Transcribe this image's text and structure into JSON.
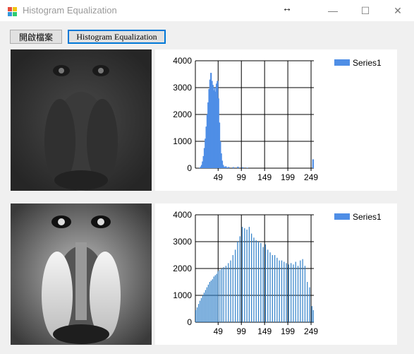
{
  "window": {
    "title": "Histogram Equalization",
    "minimize_glyph": "—",
    "maximize_glyph": "☐",
    "close_glyph": "✕",
    "cursor_glyph": "↔"
  },
  "toolbar": {
    "open_label": "開啟檔案",
    "equalize_label": "Histogram Equalization"
  },
  "images": {
    "original": {
      "description_icon": "baboon-image-dark"
    },
    "equalized": {
      "description_icon": "baboon-image-equalized"
    }
  },
  "chart_data": [
    {
      "type": "bar",
      "legend": "Series1",
      "legend_position": "top-right",
      "ylim": [
        0,
        4000
      ],
      "yticks": [
        "0",
        "1000",
        "2000",
        "3000",
        "4000"
      ],
      "xticks": [
        "49",
        "99",
        "149",
        "199",
        "249"
      ],
      "xlim": [
        0,
        255
      ],
      "grid": true,
      "color": "#4f8ee6",
      "series": [
        {
          "name": "Series1",
          "x": [
            8,
            10,
            12,
            14,
            16,
            18,
            20,
            22,
            24,
            26,
            28,
            30,
            32,
            34,
            36,
            38,
            40,
            42,
            44,
            46,
            48,
            50,
            52,
            54,
            56,
            58,
            60,
            62,
            64,
            66,
            70,
            80,
            90,
            100,
            110,
            255
          ],
          "values": [
            20,
            60,
            120,
            250,
            450,
            750,
            1100,
            1550,
            2000,
            2450,
            2950,
            3300,
            3550,
            3250,
            3100,
            2900,
            3000,
            2850,
            3150,
            3250,
            2600,
            1700,
            1000,
            550,
            280,
            120,
            60,
            40,
            70,
            30,
            45,
            40,
            55,
            35,
            20,
            330
          ]
        }
      ]
    },
    {
      "type": "bar",
      "legend": "Series1",
      "legend_position": "top-right",
      "ylim": [
        0,
        4000
      ],
      "yticks": [
        "0",
        "1000",
        "2000",
        "3000",
        "4000"
      ],
      "xticks": [
        "49",
        "99",
        "149",
        "199",
        "249"
      ],
      "xlim": [
        0,
        255
      ],
      "grid": true,
      "color": "#2e7fc8",
      "series": [
        {
          "name": "Series1",
          "x": [
            0,
            3,
            6,
            9,
            12,
            15,
            18,
            21,
            24,
            27,
            30,
            33,
            36,
            39,
            42,
            45,
            48,
            52,
            56,
            60,
            65,
            70,
            75,
            80,
            85,
            90,
            95,
            100,
            105,
            110,
            115,
            120,
            125,
            130,
            135,
            140,
            145,
            150,
            155,
            160,
            165,
            170,
            175,
            180,
            185,
            190,
            195,
            200,
            205,
            210,
            215,
            220,
            225,
            230,
            235,
            240,
            245,
            250,
            253
          ],
          "values": [
            450,
            550,
            680,
            800,
            900,
            1000,
            1100,
            1200,
            1300,
            1400,
            1500,
            1550,
            1600,
            1700,
            1750,
            1800,
            1900,
            1950,
            2000,
            2050,
            2100,
            2200,
            2300,
            2500,
            2700,
            3000,
            3200,
            3550,
            3500,
            3450,
            3550,
            3300,
            3150,
            3050,
            3000,
            2950,
            2800,
            2900,
            2700,
            2600,
            2500,
            2500,
            2400,
            2300,
            2300,
            2250,
            2200,
            2150,
            2200,
            2150,
            2250,
            2100,
            2300,
            2350,
            2100,
            1500,
            1300,
            600,
            450
          ]
        }
      ]
    }
  ]
}
